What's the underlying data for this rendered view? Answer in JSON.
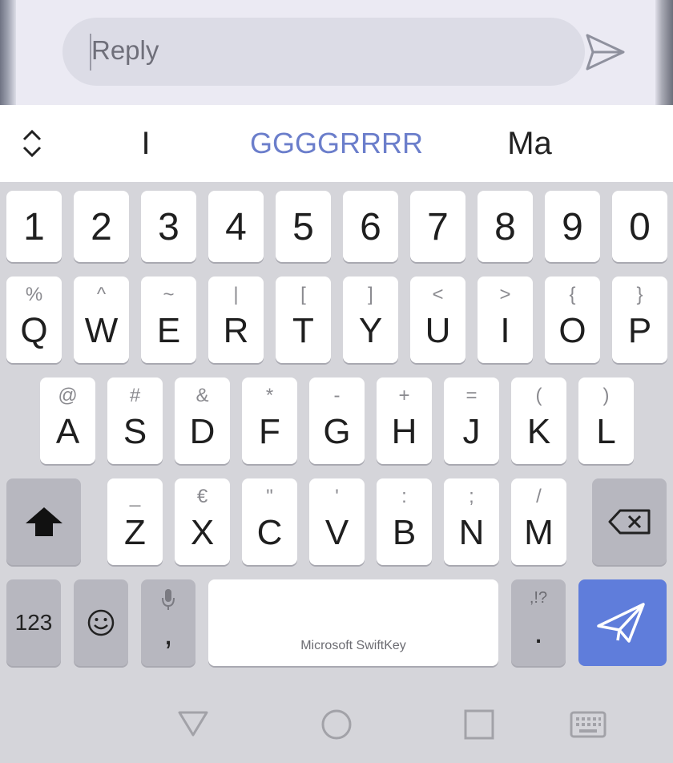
{
  "reply": {
    "placeholder": "Reply",
    "send_icon": "send-outline-icon"
  },
  "suggestions": {
    "expand_icon": "chevron-up-down-icon",
    "items": [
      "I",
      "GGGGRRRR",
      "Ma"
    ],
    "highlight_color": "#6b7ecb"
  },
  "keyboard": {
    "numbers": [
      "1",
      "2",
      "3",
      "4",
      "5",
      "6",
      "7",
      "8",
      "9",
      "0"
    ],
    "row1": [
      {
        "pri": "Q",
        "sec": "%"
      },
      {
        "pri": "W",
        "sec": "^"
      },
      {
        "pri": "E",
        "sec": "~"
      },
      {
        "pri": "R",
        "sec": "|"
      },
      {
        "pri": "T",
        "sec": "["
      },
      {
        "pri": "Y",
        "sec": "]"
      },
      {
        "pri": "U",
        "sec": "<"
      },
      {
        "pri": "I",
        "sec": ">"
      },
      {
        "pri": "O",
        "sec": "{"
      },
      {
        "pri": "P",
        "sec": "}"
      }
    ],
    "row2": [
      {
        "pri": "A",
        "sec": "@"
      },
      {
        "pri": "S",
        "sec": "#"
      },
      {
        "pri": "D",
        "sec": "&"
      },
      {
        "pri": "F",
        "sec": "*"
      },
      {
        "pri": "G",
        "sec": "-"
      },
      {
        "pri": "H",
        "sec": "+"
      },
      {
        "pri": "J",
        "sec": "="
      },
      {
        "pri": "K",
        "sec": "("
      },
      {
        "pri": "L",
        "sec": ")"
      }
    ],
    "row3": [
      {
        "pri": "Z",
        "sec": "_"
      },
      {
        "pri": "X",
        "sec": "€"
      },
      {
        "pri": "C",
        "sec": "\""
      },
      {
        "pri": "V",
        "sec": "'"
      },
      {
        "pri": "B",
        "sec": ":"
      },
      {
        "pri": "N",
        "sec": ";"
      },
      {
        "pri": "M",
        "sec": "/"
      }
    ],
    "bottom": {
      "numbers_label": "123",
      "comma_label": ",",
      "space_brand": "Microsoft SwiftKey",
      "period_label": ".",
      "period_secondary": ",!?"
    },
    "accent_color": "#5f7ddb"
  },
  "navbar": {
    "icons": [
      "back-triangle-icon",
      "home-circle-icon",
      "recents-square-icon",
      "keyboard-icon"
    ]
  }
}
